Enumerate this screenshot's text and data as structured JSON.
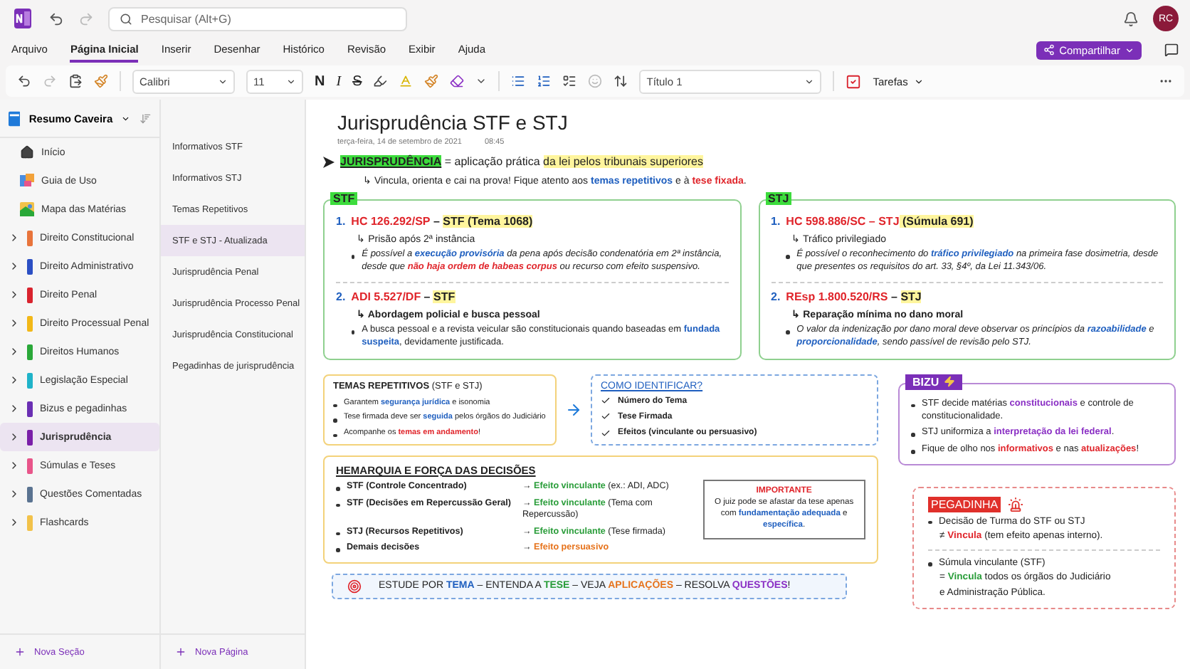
{
  "app": {
    "search_placeholder": "Pesquisar (Alt+G)",
    "avatar": "RC"
  },
  "menu": {
    "tabs": [
      {
        "label": "Arquivo",
        "selected": false
      },
      {
        "label": "Página Inicial",
        "selected": true
      },
      {
        "label": "Inserir",
        "selected": false
      },
      {
        "label": "Desenhar",
        "selected": false
      },
      {
        "label": "Histórico",
        "selected": false
      },
      {
        "label": "Revisão",
        "selected": false
      },
      {
        "label": "Exibir",
        "selected": false
      },
      {
        "label": "Ajuda",
        "selected": false
      }
    ],
    "share": "Compartilhar"
  },
  "toolbar": {
    "font": "Calibri",
    "size": "11",
    "bold": "N",
    "italic": "I",
    "strike": "S",
    "style": "Título 1",
    "tasks": "Tarefas"
  },
  "notebook": {
    "name": "Resumo Caveira"
  },
  "sections": [
    {
      "kind": "home",
      "label": "Início",
      "selected": false
    },
    {
      "kind": "guide",
      "label": "Guia de Uso",
      "selected": false
    },
    {
      "kind": "map",
      "label": "Mapa das Matérias",
      "selected": false
    },
    {
      "kind": "section",
      "label": "Direito Constitucional",
      "color": "#e8743b",
      "selected": false
    },
    {
      "kind": "section",
      "label": "Direito Administrativo",
      "color": "#2b4fc4",
      "selected": false
    },
    {
      "kind": "section",
      "label": "Direito Penal",
      "color": "#d9232e",
      "selected": false
    },
    {
      "kind": "section",
      "label": "Direito Processual Penal",
      "color": "#f2b818",
      "selected": false
    },
    {
      "kind": "section",
      "label": "Direitos Humanos",
      "color": "#2aa839",
      "selected": false
    },
    {
      "kind": "section",
      "label": "Legislação Especial",
      "color": "#1fb3c9",
      "selected": false
    },
    {
      "kind": "section",
      "label": "Bizus e pegadinhas",
      "color": "#6a2fb3",
      "selected": false
    },
    {
      "kind": "section",
      "label": "Jurisprudência",
      "color": "#7a1fa8",
      "selected": true
    },
    {
      "kind": "section",
      "label": "Súmulas e Teses",
      "color": "#e8558a",
      "selected": false
    },
    {
      "kind": "section",
      "label": "Questões Comentadas",
      "color": "#5a7391",
      "selected": false
    },
    {
      "kind": "section",
      "label": "Flashcards",
      "color": "#f2c24a",
      "selected": false
    }
  ],
  "new_section": "Nova Seção",
  "pages": [
    {
      "label": "Informativos STF",
      "selected": false
    },
    {
      "label": "Informativos STJ",
      "selected": false
    },
    {
      "label": "Temas Repetitivos",
      "selected": false
    },
    {
      "label": "STF e STJ - Atualizada",
      "selected": true
    },
    {
      "label": "Jurisprudência Penal",
      "selected": false
    },
    {
      "label": "Jurisprudência Processo Penal",
      "selected": false
    },
    {
      "label": "Jurisprudência Constitucional",
      "selected": false
    },
    {
      "label": "Pegadinhas de jurisprudência",
      "selected": false
    }
  ],
  "new_page": "Nova Página",
  "page": {
    "title": "Jurisprudência STF e STJ",
    "date": "terça-feira, 14 de setembro de 2021",
    "time": "08:45",
    "intro": [
      {
        "kind": "key",
        "t": "JURISPRUDÊNCIA"
      },
      {
        "kind": "plain",
        "t": " = aplicação prática "
      },
      {
        "kind": "hl",
        "t": "da lei pelos tribunais superiores"
      }
    ],
    "intro_note": [
      {
        "kind": "plain",
        "t": "↳ Vincula, orienta e cai na prova! Fique atento aos "
      },
      {
        "kind": "blue",
        "t": "temas repetitivos"
      },
      {
        "kind": "plain",
        "t": " e à "
      },
      {
        "kind": "red",
        "t": "tese fixada"
      },
      {
        "kind": "plain",
        "t": "."
      }
    ],
    "courts": [
      {
        "tag": "STF",
        "items": [
          {
            "num": "1.",
            "heading": [
              {
                "kind": "red",
                "t": "HC 126.292/SP"
              },
              {
                "kind": "plain",
                "t": " – "
              },
              {
                "kind": "hl",
                "t": "STF (Tema 1068)"
              }
            ],
            "sub": {
              "bold": false,
              "text": "↳ Prisão após 2ª instância"
            },
            "bullet": {
              "italic": true,
              "segs": [
                {
                  "kind": "plain",
                  "t": "É possível a "
                },
                {
                  "kind": "blue",
                  "t": "execução provisória"
                },
                {
                  "kind": "plain",
                  "t": " da pena após decisão condenatória em 2ª instância, desde que "
                },
                {
                  "kind": "red",
                  "t": "não haja ordem de habeas corpus"
                },
                {
                  "kind": "plain",
                  "t": " ou recurso com efeito suspensivo."
                }
              ]
            }
          },
          {
            "num": "2.",
            "heading": [
              {
                "kind": "red",
                "t": "ADI 5.527/DF"
              },
              {
                "kind": "plain",
                "t": " – "
              },
              {
                "kind": "hl",
                "t": "STF"
              }
            ],
            "sub": {
              "bold": true,
              "text": "↳ Abordagem policial e busca pessoal"
            },
            "bullet": {
              "italic": false,
              "segs": [
                {
                  "kind": "plain",
                  "t": "A busca pessoal e a revista veicular são constitucionais quando baseadas em "
                },
                {
                  "kind": "blue",
                  "t": "fundada suspeita"
                },
                {
                  "kind": "plain",
                  "t": ", devidamente justificada."
                }
              ]
            }
          }
        ]
      },
      {
        "tag": "STJ",
        "items": [
          {
            "num": "1.",
            "heading": [
              {
                "kind": "red",
                "t": "HC 598.886/SC – STJ"
              },
              {
                "kind": "hl",
                "t": " (Súmula 691)"
              }
            ],
            "sub": {
              "bold": false,
              "text": "↳ Tráfico privilegiado"
            },
            "bullet": {
              "italic": true,
              "segs": [
                {
                  "kind": "plain",
                  "t": "É possível o reconhecimento do "
                },
                {
                  "kind": "blue",
                  "t": "tráfico privilegiado"
                },
                {
                  "kind": "plain",
                  "t": " na primeira fase dosimetria, desde que presentes os requisitos do art. 33, §4º, da Lei 11.343/06."
                }
              ]
            }
          },
          {
            "num": "2.",
            "heading": [
              {
                "kind": "red",
                "t": "REsp 1.800.520/RS"
              },
              {
                "kind": "plain",
                "t": " – "
              },
              {
                "kind": "hl",
                "t": "STJ"
              }
            ],
            "sub": {
              "bold": true,
              "text": "↳ Reparação mínima no dano moral"
            },
            "bullet": {
              "italic": true,
              "segs": [
                {
                  "kind": "plain",
                  "t": "O valor da indenização por dano moral deve observar os princípios da "
                },
                {
                  "kind": "blue",
                  "t": "razoabilidade"
                },
                {
                  "kind": "plain",
                  "t": " e "
                },
                {
                  "kind": "blue",
                  "t": "proporcionalidade"
                },
                {
                  "kind": "plain",
                  "t": ", sendo passível de revisão pelo STJ."
                }
              ]
            }
          }
        ]
      }
    ],
    "temas": {
      "title": [
        {
          "kind": "bold",
          "t": "TEMAS REPETITIVOS"
        },
        {
          "kind": "plain",
          "t": " (STF e STJ)"
        }
      ],
      "bullets": [
        [
          {
            "kind": "plain",
            "t": "Garantem "
          },
          {
            "kind": "blue",
            "t": "segurança jurídica"
          },
          {
            "kind": "plain",
            "t": " e isonomia"
          }
        ],
        [
          {
            "kind": "plain",
            "t": "Tese firmada deve ser "
          },
          {
            "kind": "blue",
            "t": "seguida"
          },
          {
            "kind": "plain",
            "t": " pelos órgãos do Judiciário"
          }
        ],
        [
          {
            "kind": "plain",
            "t": "Acompanhe os "
          },
          {
            "kind": "red",
            "t": "temas em andamento"
          },
          {
            "kind": "plain",
            "t": "!"
          }
        ]
      ]
    },
    "como": {
      "title": "COMO IDENTIFICAR?",
      "checks": [
        "Número do Tema",
        "Tese Firmada",
        "Efeitos (vinculante ou persuasivo)"
      ]
    },
    "bizu": {
      "tag": "BIZU",
      "bullets": [
        [
          {
            "kind": "plain",
            "t": "STF decide matérias "
          },
          {
            "kind": "purple",
            "t": "constitucionais"
          },
          {
            "kind": "plain",
            "t": " e controle de constitucionalidade."
          }
        ],
        [
          {
            "kind": "plain",
            "t": "STJ uniformiza a "
          },
          {
            "kind": "purple",
            "t": "interpretação da lei federal"
          },
          {
            "kind": "plain",
            "t": "."
          }
        ],
        [
          {
            "kind": "plain",
            "t": "Fique de olho nos "
          },
          {
            "kind": "red",
            "t": "informativos"
          },
          {
            "kind": "plain",
            "t": " e nas "
          },
          {
            "kind": "red",
            "t": "atualizações"
          },
          {
            "kind": "plain",
            "t": "!"
          }
        ]
      ]
    },
    "hierarquia": {
      "title": "HEMARQUIA E FORÇA DAS DECISÕES",
      "rows": [
        {
          "left": "STF (Controle Concentrado)",
          "right": [
            {
              "kind": "plain",
              "t": "→ "
            },
            {
              "kind": "green",
              "t": "Efeito vinculante"
            },
            {
              "kind": "plain",
              "t": " (ex.: ADI, ADC)"
            }
          ]
        },
        {
          "left": "STF (Decisões em Repercussão Geral)",
          "right": [
            {
              "kind": "plain",
              "t": "→ "
            },
            {
              "kind": "green",
              "t": "Efeito vinculante"
            },
            {
              "kind": "plain",
              "t": " (Tema com Repercussão)"
            }
          ]
        },
        {
          "left": "STJ (Recursos Repetitivos)",
          "right": [
            {
              "kind": "plain",
              "t": "→ "
            },
            {
              "kind": "green",
              "t": "Efeito vinculante"
            },
            {
              "kind": "plain",
              "t": " (Tese firmada)"
            }
          ]
        },
        {
          "left": "Demais decisões",
          "right": [
            {
              "kind": "plain",
              "t": "→ "
            },
            {
              "kind": "orange",
              "t": "Efeito persuasivo"
            }
          ]
        }
      ],
      "important": {
        "title": "IMPORTANTE",
        "text": [
          {
            "kind": "plain",
            "t": "O juiz pode se afastar da tese apenas com "
          },
          {
            "kind": "blue",
            "t": "fundamentação adequada"
          },
          {
            "kind": "plain",
            "t": " e "
          },
          {
            "kind": "blue",
            "t": "específica"
          },
          {
            "kind": "plain",
            "t": "."
          }
        ]
      }
    },
    "pegadinha": {
      "tag": "PEGADINHA",
      "items": [
        [
          [
            {
              "kind": "plain",
              "t": "Decisão de Turma do STF ou STJ"
            }
          ],
          [
            {
              "kind": "plain",
              "t": "≠ "
            },
            {
              "kind": "red",
              "t": "Vincula"
            },
            {
              "kind": "plain",
              "t": " (tem efeito apenas interno)."
            }
          ]
        ],
        [
          [
            {
              "kind": "plain",
              "t": "Súmula vinculante (STF)"
            }
          ],
          [
            {
              "kind": "plain",
              "t": "= "
            },
            {
              "kind": "green",
              "t": "Vincula"
            },
            {
              "kind": "plain",
              "t": " todos os órgãos do Judiciário"
            }
          ],
          [
            {
              "kind": "plain",
              "t": "e Administração Pública."
            }
          ]
        ]
      ]
    },
    "banner": [
      {
        "kind": "plain",
        "t": "ESTUDE POR "
      },
      {
        "kind": "blue",
        "t": "TEMA"
      },
      {
        "kind": "plain",
        "t": " – ENTENDA A "
      },
      {
        "kind": "green",
        "t": "TESE"
      },
      {
        "kind": "plain",
        "t": " – VEJA "
      },
      {
        "kind": "orange",
        "t": "APLICAÇÕES"
      },
      {
        "kind": "plain",
        "t": " – RESOLVA "
      },
      {
        "kind": "purple",
        "t": "QUESTÕES"
      },
      {
        "kind": "plain",
        "t": "!"
      }
    ]
  }
}
